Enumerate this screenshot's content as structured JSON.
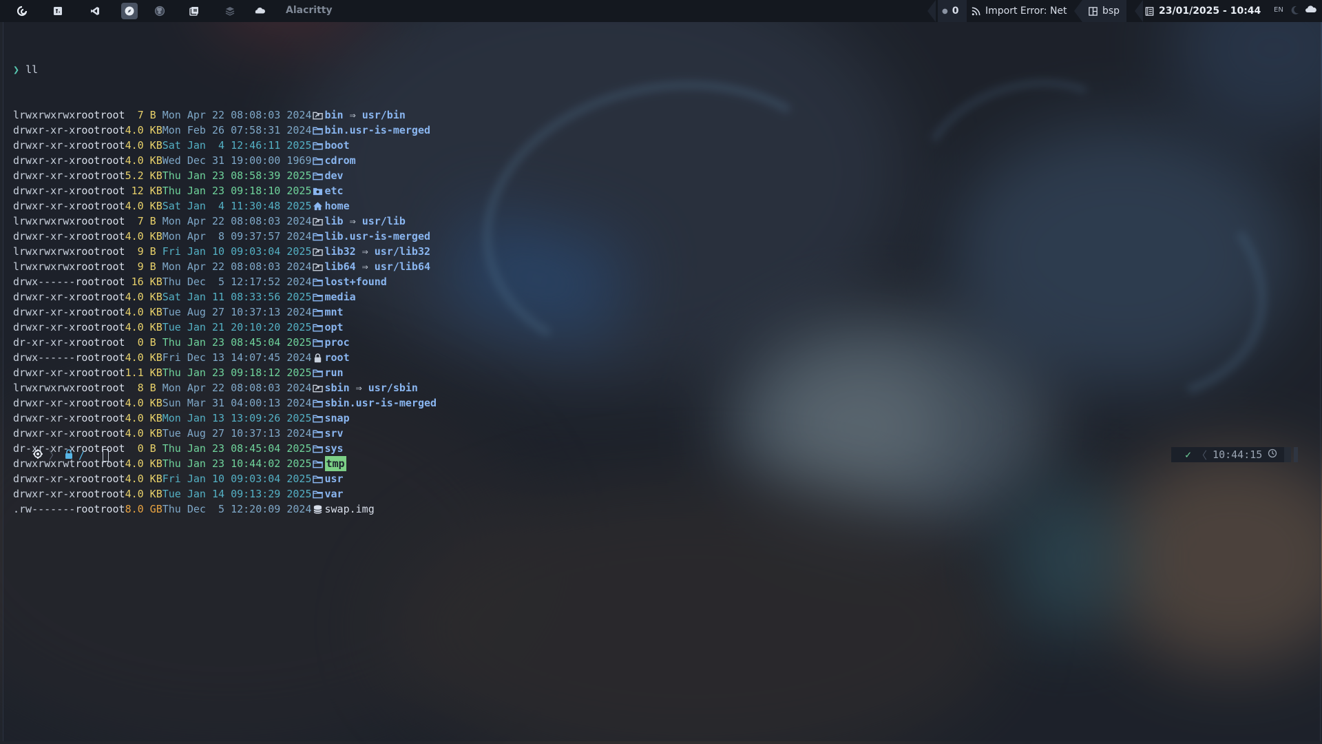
{
  "topbar": {
    "workspace_icons": [
      "debian-icon",
      "terminal-icon",
      "vscode-icon",
      "compass-icon",
      "github-icon",
      "files-icon",
      "layers-icon",
      "cloud-icon"
    ],
    "active_workspace": 3,
    "app_title": "Alacritty",
    "counter": "0",
    "network": "Import Error: Net",
    "layout": "bsp",
    "datetime": "23/01/2025 - 10:44",
    "lang": "EN"
  },
  "terminal": {
    "prompt_symbol": "❯",
    "command": "ll",
    "listing": [
      {
        "perm": "lrwxrwxrwx",
        "owner": "root",
        "group": "root",
        "size": "  7 B ",
        "day": "Mon",
        "mon": "Apr",
        "dd": "22",
        "time": "08:08:03",
        "year": "2024",
        "icon": "symlink-icon",
        "name": "bin",
        "target": "usr/bin",
        "age": "dim"
      },
      {
        "perm": "drwxr-xr-x",
        "owner": "root",
        "group": "root",
        "size": "4.0 KB",
        "day": "Mon",
        "mon": "Feb",
        "dd": "26",
        "time": "07:58:31",
        "year": "2024",
        "icon": "folder-icon",
        "name": "bin.usr-is-merged",
        "age": "dim"
      },
      {
        "perm": "drwxr-xr-x",
        "owner": "root",
        "group": "root",
        "size": "4.0 KB",
        "day": "Sat",
        "mon": "Jan",
        "dd": " 4",
        "time": "12:46:11",
        "year": "2025",
        "icon": "folder-icon",
        "name": "boot",
        "age": "mid"
      },
      {
        "perm": "drwxr-xr-x",
        "owner": "root",
        "group": "root",
        "size": "4.0 KB",
        "day": "Wed",
        "mon": "Dec",
        "dd": "31",
        "time": "19:00:00",
        "year": "1969",
        "icon": "folder-icon",
        "name": "cdrom",
        "age": "dim"
      },
      {
        "perm": "drwxr-xr-x",
        "owner": "root",
        "group": "root",
        "size": "5.2 KB",
        "day": "Thu",
        "mon": "Jan",
        "dd": "23",
        "time": "08:58:39",
        "year": "2025",
        "icon": "folder-icon",
        "name": "dev",
        "age": "new"
      },
      {
        "perm": "drwxr-xr-x",
        "owner": "root",
        "group": "root",
        "size": " 12 KB",
        "day": "Thu",
        "mon": "Jan",
        "dd": "23",
        "time": "09:18:10",
        "year": "2025",
        "icon": "config-folder-icon",
        "name": "etc",
        "age": "new"
      },
      {
        "perm": "drwxr-xr-x",
        "owner": "root",
        "group": "root",
        "size": "4.0 KB",
        "day": "Sat",
        "mon": "Jan",
        "dd": " 4",
        "time": "11:30:48",
        "year": "2025",
        "icon": "home-icon",
        "name": "home",
        "age": "mid"
      },
      {
        "perm": "lrwxrwxrwx",
        "owner": "root",
        "group": "root",
        "size": "  7 B ",
        "day": "Mon",
        "mon": "Apr",
        "dd": "22",
        "time": "08:08:03",
        "year": "2024",
        "icon": "symlink-icon",
        "name": "lib",
        "target": "usr/lib",
        "age": "dim"
      },
      {
        "perm": "drwxr-xr-x",
        "owner": "root",
        "group": "root",
        "size": "4.0 KB",
        "day": "Mon",
        "mon": "Apr",
        "dd": " 8",
        "time": "09:37:57",
        "year": "2024",
        "icon": "folder-icon",
        "name": "lib.usr-is-merged",
        "age": "dim"
      },
      {
        "perm": "lrwxrwxrwx",
        "owner": "root",
        "group": "root",
        "size": "  9 B ",
        "day": "Fri",
        "mon": "Jan",
        "dd": "10",
        "time": "09:03:04",
        "year": "2025",
        "icon": "symlink-icon",
        "name": "lib32",
        "target": "usr/lib32",
        "age": "mid"
      },
      {
        "perm": "lrwxrwxrwx",
        "owner": "root",
        "group": "root",
        "size": "  9 B ",
        "day": "Mon",
        "mon": "Apr",
        "dd": "22",
        "time": "08:08:03",
        "year": "2024",
        "icon": "symlink-icon",
        "name": "lib64",
        "target": "usr/lib64",
        "age": "dim"
      },
      {
        "perm": "drwx------",
        "owner": "root",
        "group": "root",
        "size": " 16 KB",
        "day": "Thu",
        "mon": "Dec",
        "dd": " 5",
        "time": "12:17:52",
        "year": "2024",
        "icon": "folder-icon",
        "name": "lost+found",
        "age": "dim"
      },
      {
        "perm": "drwxr-xr-x",
        "owner": "root",
        "group": "root",
        "size": "4.0 KB",
        "day": "Sat",
        "mon": "Jan",
        "dd": "11",
        "time": "08:33:56",
        "year": "2025",
        "icon": "folder-icon",
        "name": "media",
        "age": "mid"
      },
      {
        "perm": "drwxr-xr-x",
        "owner": "root",
        "group": "root",
        "size": "4.0 KB",
        "day": "Tue",
        "mon": "Aug",
        "dd": "27",
        "time": "10:37:13",
        "year": "2024",
        "icon": "folder-icon",
        "name": "mnt",
        "age": "dim"
      },
      {
        "perm": "drwxr-xr-x",
        "owner": "root",
        "group": "root",
        "size": "4.0 KB",
        "day": "Tue",
        "mon": "Jan",
        "dd": "21",
        "time": "20:10:20",
        "year": "2025",
        "icon": "folder-icon",
        "name": "opt",
        "age": "mid"
      },
      {
        "perm": "dr-xr-xr-x",
        "owner": "root",
        "group": "root",
        "size": "  0 B ",
        "day": "Thu",
        "mon": "Jan",
        "dd": "23",
        "time": "08:45:04",
        "year": "2025",
        "icon": "folder-icon",
        "name": "proc",
        "age": "new"
      },
      {
        "perm": "drwx------",
        "owner": "root",
        "group": "root",
        "size": "4.0 KB",
        "day": "Fri",
        "mon": "Dec",
        "dd": "13",
        "time": "14:07:45",
        "year": "2024",
        "icon": "lock-icon",
        "name": "root",
        "age": "dim"
      },
      {
        "perm": "drwxr-xr-x",
        "owner": "root",
        "group": "root",
        "size": "1.1 KB",
        "day": "Thu",
        "mon": "Jan",
        "dd": "23",
        "time": "09:18:12",
        "year": "2025",
        "icon": "folder-icon",
        "name": "run",
        "age": "new"
      },
      {
        "perm": "lrwxrwxrwx",
        "owner": "root",
        "group": "root",
        "size": "  8 B ",
        "day": "Mon",
        "mon": "Apr",
        "dd": "22",
        "time": "08:08:03",
        "year": "2024",
        "icon": "symlink-icon",
        "name": "sbin",
        "target": "usr/sbin",
        "age": "dim"
      },
      {
        "perm": "drwxr-xr-x",
        "owner": "root",
        "group": "root",
        "size": "4.0 KB",
        "day": "Sun",
        "mon": "Mar",
        "dd": "31",
        "time": "04:00:13",
        "year": "2024",
        "icon": "folder-icon",
        "name": "sbin.usr-is-merged",
        "age": "dim"
      },
      {
        "perm": "drwxr-xr-x",
        "owner": "root",
        "group": "root",
        "size": "4.0 KB",
        "day": "Mon",
        "mon": "Jan",
        "dd": "13",
        "time": "13:09:26",
        "year": "2025",
        "icon": "folder-icon",
        "name": "snap",
        "age": "mid"
      },
      {
        "perm": "drwxr-xr-x",
        "owner": "root",
        "group": "root",
        "size": "4.0 KB",
        "day": "Tue",
        "mon": "Aug",
        "dd": "27",
        "time": "10:37:13",
        "year": "2024",
        "icon": "folder-icon",
        "name": "srv",
        "age": "dim"
      },
      {
        "perm": "dr-xr-xr-x",
        "owner": "root",
        "group": "root",
        "size": "  0 B ",
        "day": "Thu",
        "mon": "Jan",
        "dd": "23",
        "time": "08:45:04",
        "year": "2025",
        "icon": "folder-icon",
        "name": "sys",
        "age": "new"
      },
      {
        "perm": "drwxrwxrwt",
        "owner": "root",
        "group": "root",
        "size": "4.0 KB",
        "day": "Thu",
        "mon": "Jan",
        "dd": "23",
        "time": "10:44:02",
        "year": "2025",
        "icon": "folder-icon",
        "name": "tmp",
        "age": "new",
        "highlight": true
      },
      {
        "perm": "drwxr-xr-x",
        "owner": "root",
        "group": "root",
        "size": "4.0 KB",
        "day": "Fri",
        "mon": "Jan",
        "dd": "10",
        "time": "09:03:04",
        "year": "2025",
        "icon": "folder-icon",
        "name": "usr",
        "age": "mid"
      },
      {
        "perm": "drwxr-xr-x",
        "owner": "root",
        "group": "root",
        "size": "4.0 KB",
        "day": "Tue",
        "mon": "Jan",
        "dd": "14",
        "time": "09:13:29",
        "year": "2025",
        "icon": "folder-icon",
        "name": "var",
        "age": "mid"
      },
      {
        "perm": ".rw-------",
        "owner": "root",
        "group": "root",
        "size": "8.0 GB",
        "day": "Thu",
        "mon": "Dec",
        "dd": " 5",
        "time": "12:20:09",
        "year": "2024",
        "icon": "database-icon",
        "name": "swap.img",
        "age": "dim",
        "file": true
      }
    ],
    "prompt": {
      "os_icon": "gear-icon",
      "lock_icon": "lock-icon",
      "path": "/"
    },
    "right_prompt": {
      "status": "✓",
      "time": "10:44:15",
      "clock_icon": "clock-icon"
    }
  },
  "colors": {
    "folder": "#8ab6f0",
    "size": "#e8d16a",
    "size_big": "#e8a341",
    "date_new": "#6fd39b",
    "date_mid": "#54b0c4",
    "date_dim": "#7fa8c8",
    "highlight": "#7ccf86"
  }
}
